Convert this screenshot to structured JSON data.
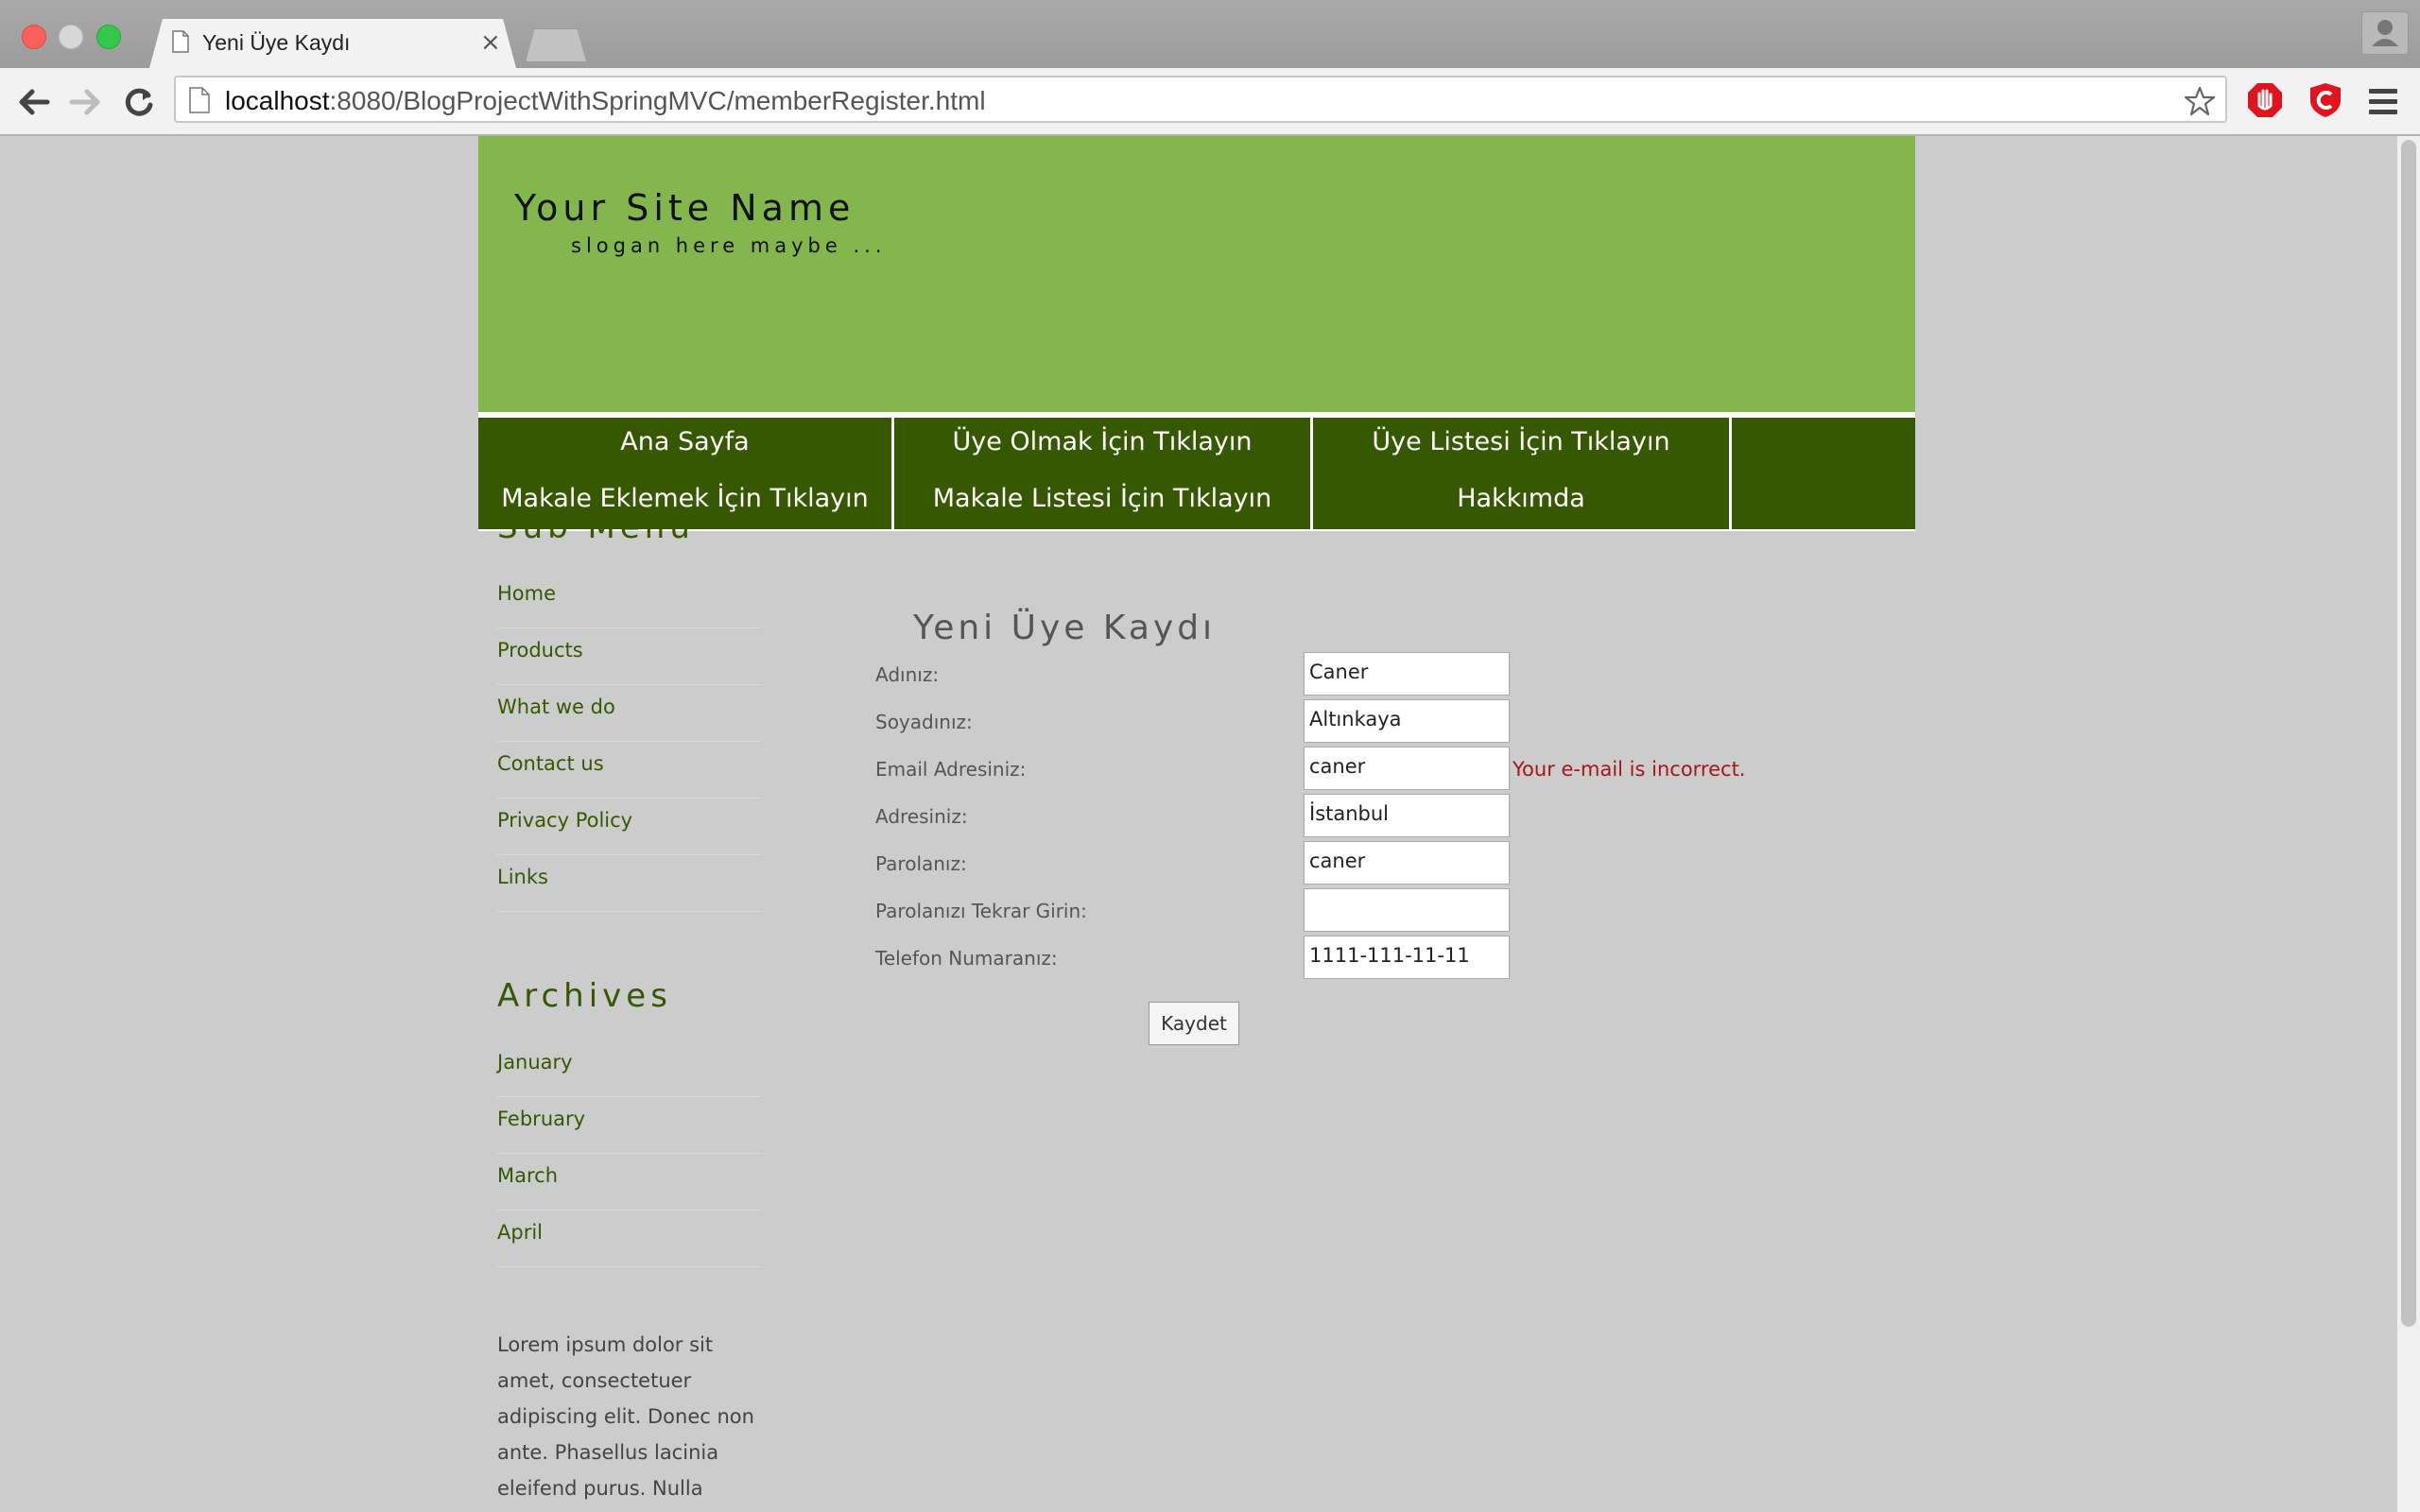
{
  "browser": {
    "tab_title": "Yeni Üye Kaydı",
    "tab_close": "×",
    "url_host": "localhost",
    "url_path": ":8080/BlogProjectWithSpringMVC/memberRegister.html",
    "icons": [
      "back-arrow-icon",
      "forward-arrow-icon",
      "reload-icon",
      "page-icon",
      "bookmark-star-icon",
      "adblock-icon",
      "extension-shield-icon",
      "menu-icon",
      "profile-icon"
    ]
  },
  "header": {
    "site_name": "Your Site Name",
    "slogan": "slogan here maybe ...",
    "bg_color": "#83b74e"
  },
  "nav": {
    "bg_color": "#355800",
    "links": [
      "Ana Sayfa",
      "Üye Olmak İçin Tıklayın",
      "Üye Listesi İçin Tıklayın",
      "Makale Eklemek İçin Tıklayın",
      "Makale Listesi İçin Tıklayın",
      "Hakkımda"
    ]
  },
  "sidebar": {
    "submenu_title": "Sub Menu",
    "submenu": [
      "Home",
      "Products",
      "What we do",
      "Contact us",
      "Privacy Policy",
      "Links"
    ],
    "archives_title": "Archives",
    "archives": [
      "January",
      "February",
      "March",
      "April"
    ],
    "paragraph": "Lorem ipsum dolor sit amet, consectetuer adipiscing elit. Donec non ante. Phasellus lacinia eleifend purus. Nulla"
  },
  "form": {
    "title": "Yeni Üye Kaydı",
    "fields": [
      {
        "label": "Adınız:",
        "value": "Caner"
      },
      {
        "label": "Soyadınız:",
        "value": "Altınkaya"
      },
      {
        "label": "Email Adresiniz:",
        "value": "caner"
      },
      {
        "label": "Adresiniz:",
        "value": "İstanbul"
      },
      {
        "label": "Parolanız:",
        "value": "caner"
      },
      {
        "label": "Parolanızı Tekrar Girin:",
        "value": ""
      },
      {
        "label": "Telefon Numaranız:",
        "value": "1111-111-11-11"
      }
    ],
    "email_error": "Your e-mail is incorrect.",
    "error_color": "#a3171b",
    "submit_label": "Kaydet"
  }
}
